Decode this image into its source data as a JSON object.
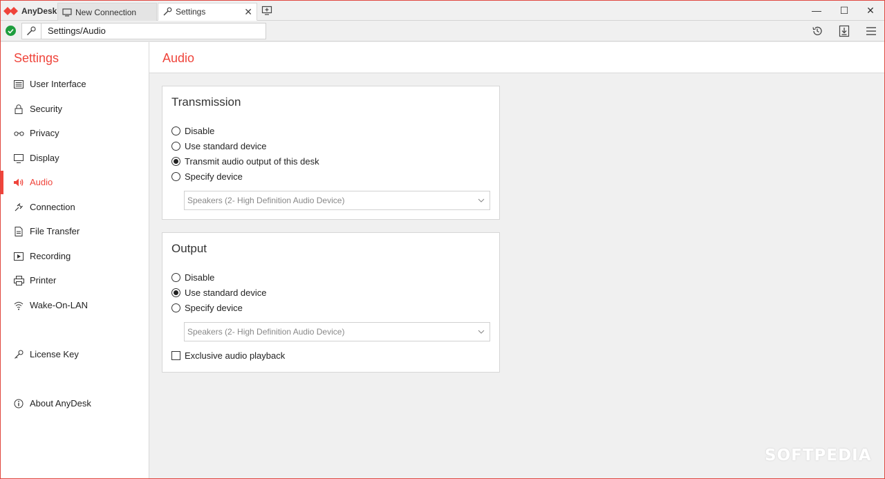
{
  "app": {
    "name": "AnyDesk",
    "brand_color": "#ef443b"
  },
  "tabs": [
    {
      "label": "New Connection",
      "icon": "monitor-icon"
    },
    {
      "label": "Settings",
      "icon": "wrench-icon",
      "close": "✕"
    }
  ],
  "window_controls": {
    "minimize": "—",
    "maximize": "☐",
    "close": "✕"
  },
  "address": {
    "value": "Settings/Audio",
    "status": "online"
  },
  "toolbar_icons": [
    "history-icon",
    "download-icon",
    "menu-icon"
  ],
  "sidebar": {
    "title": "Settings",
    "items": [
      {
        "label": "User Interface",
        "icon": "keyboard-icon"
      },
      {
        "label": "Security",
        "icon": "lock-icon"
      },
      {
        "label": "Privacy",
        "icon": "glasses-icon"
      },
      {
        "label": "Display",
        "icon": "monitor-icon"
      },
      {
        "label": "Audio",
        "icon": "speaker-icon",
        "active": true
      },
      {
        "label": "Connection",
        "icon": "connection-icon"
      },
      {
        "label": "File Transfer",
        "icon": "file-icon"
      },
      {
        "label": "Recording",
        "icon": "recording-icon"
      },
      {
        "label": "Printer",
        "icon": "printer-icon"
      },
      {
        "label": "Wake-On-LAN",
        "icon": "wifi-icon"
      },
      {
        "label": "License Key",
        "icon": "key-icon"
      },
      {
        "label": "About AnyDesk",
        "icon": "info-icon"
      }
    ]
  },
  "main": {
    "title": "Audio",
    "transmission": {
      "title": "Transmission",
      "options": [
        "Disable",
        "Use standard device",
        "Transmit audio output of this desk",
        "Specify device"
      ],
      "selected": "Transmit audio output of this desk",
      "device": "Speakers (2- High Definition Audio Device)"
    },
    "output": {
      "title": "Output",
      "options": [
        "Disable",
        "Use standard device",
        "Specify device"
      ],
      "selected": "Use standard device",
      "device": "Speakers (2- High Definition Audio Device)",
      "exclusive_label": "Exclusive audio playback",
      "exclusive_checked": false
    }
  },
  "watermark": "SOFTPEDIA"
}
